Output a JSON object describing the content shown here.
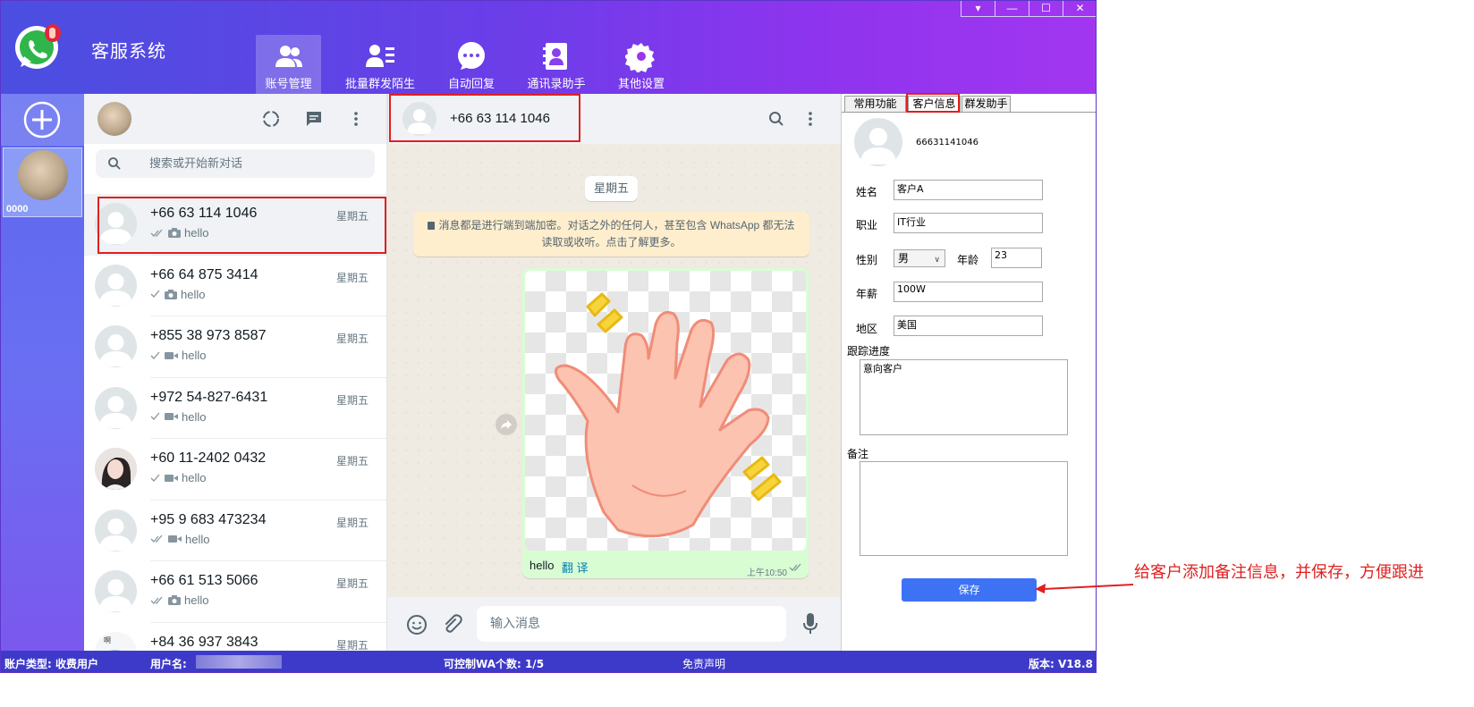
{
  "app": {
    "title": "客服系统"
  },
  "window_controls": {
    "menu": "▾",
    "minimize": "—",
    "maximize": "☐",
    "close": "✕"
  },
  "nav": [
    {
      "label": "账号管理",
      "icon": "users-icon"
    },
    {
      "label": "批量群发陌生人",
      "icon": "contact-list-icon"
    },
    {
      "label": "自动回复",
      "icon": "chat-bubble-icon"
    },
    {
      "label": "通讯录助手",
      "icon": "address-book-icon"
    },
    {
      "label": "其他设置",
      "icon": "gear-icon"
    }
  ],
  "account": {
    "number": "0000"
  },
  "search": {
    "placeholder": "搜索或开始新对话"
  },
  "chats": [
    {
      "name": "+66 63 114 1046",
      "time": "星期五",
      "preview": "hello",
      "media": "photo",
      "ticks": "double"
    },
    {
      "name": "+66 64 875 3414",
      "time": "星期五",
      "preview": "hello",
      "media": "photo",
      "ticks": "single"
    },
    {
      "name": "+855 38 973 8587",
      "time": "星期五",
      "preview": "hello",
      "media": "video",
      "ticks": "single"
    },
    {
      "name": "+972 54-827-6431",
      "time": "星期五",
      "preview": "hello",
      "media": "video",
      "ticks": "single"
    },
    {
      "name": "+60 11-2402 0432",
      "time": "星期五",
      "preview": "hello",
      "media": "video",
      "ticks": "single"
    },
    {
      "name": "+95 9 683 473234",
      "time": "星期五",
      "preview": "hello",
      "media": "video",
      "ticks": "double"
    },
    {
      "name": "+66 61 513 5066",
      "time": "星期五",
      "preview": "hello",
      "media": "photo",
      "ticks": "double"
    },
    {
      "name": "+84 36 937 3843",
      "time": "星期五",
      "preview": "",
      "media": "",
      "ticks": ""
    }
  ],
  "conversation": {
    "contact": "+66 63 114 1046",
    "day": "星期五",
    "encryption_notice": "消息都是进行端到端加密。对话之外的任何人，甚至包含 WhatsApp 都无法读取或收听。点击了解更多。",
    "message": {
      "text": "hello",
      "translate": "翻 译",
      "time": "上午10:50"
    },
    "input_placeholder": "输入消息"
  },
  "right_panel": {
    "tabs": [
      "常用功能",
      "客户信息",
      "群发助手"
    ],
    "active_tab": "客户信息",
    "customer_id": "66631141046",
    "fields": {
      "name_label": "姓名",
      "name": "客户A",
      "job_label": "职业",
      "job": "IT行业",
      "gender_label": "性别",
      "gender": "男",
      "age_label": "年龄",
      "age": "23",
      "salary_label": "年薪",
      "salary": "100W",
      "region_label": "地区",
      "region": "美国",
      "progress_label": "跟踪进度",
      "progress": "意向客户",
      "note_label": "备注",
      "note": ""
    },
    "save_label": "保存"
  },
  "statusbar": {
    "account_type": "账户类型: 收费用户",
    "username_label": "用户名:",
    "wa_count": "可控制WA个数:  1/5",
    "disclaimer": "免责声明",
    "version": "版本: V18.8"
  },
  "annotation": "给客户添加备注信息，并保存，方便跟进",
  "colors": {
    "accent": "#3d72f5",
    "highlight": "#e02020",
    "header_start": "#4a4fe0",
    "header_end": "#a236f0",
    "statusbar": "#3e3ac9"
  }
}
